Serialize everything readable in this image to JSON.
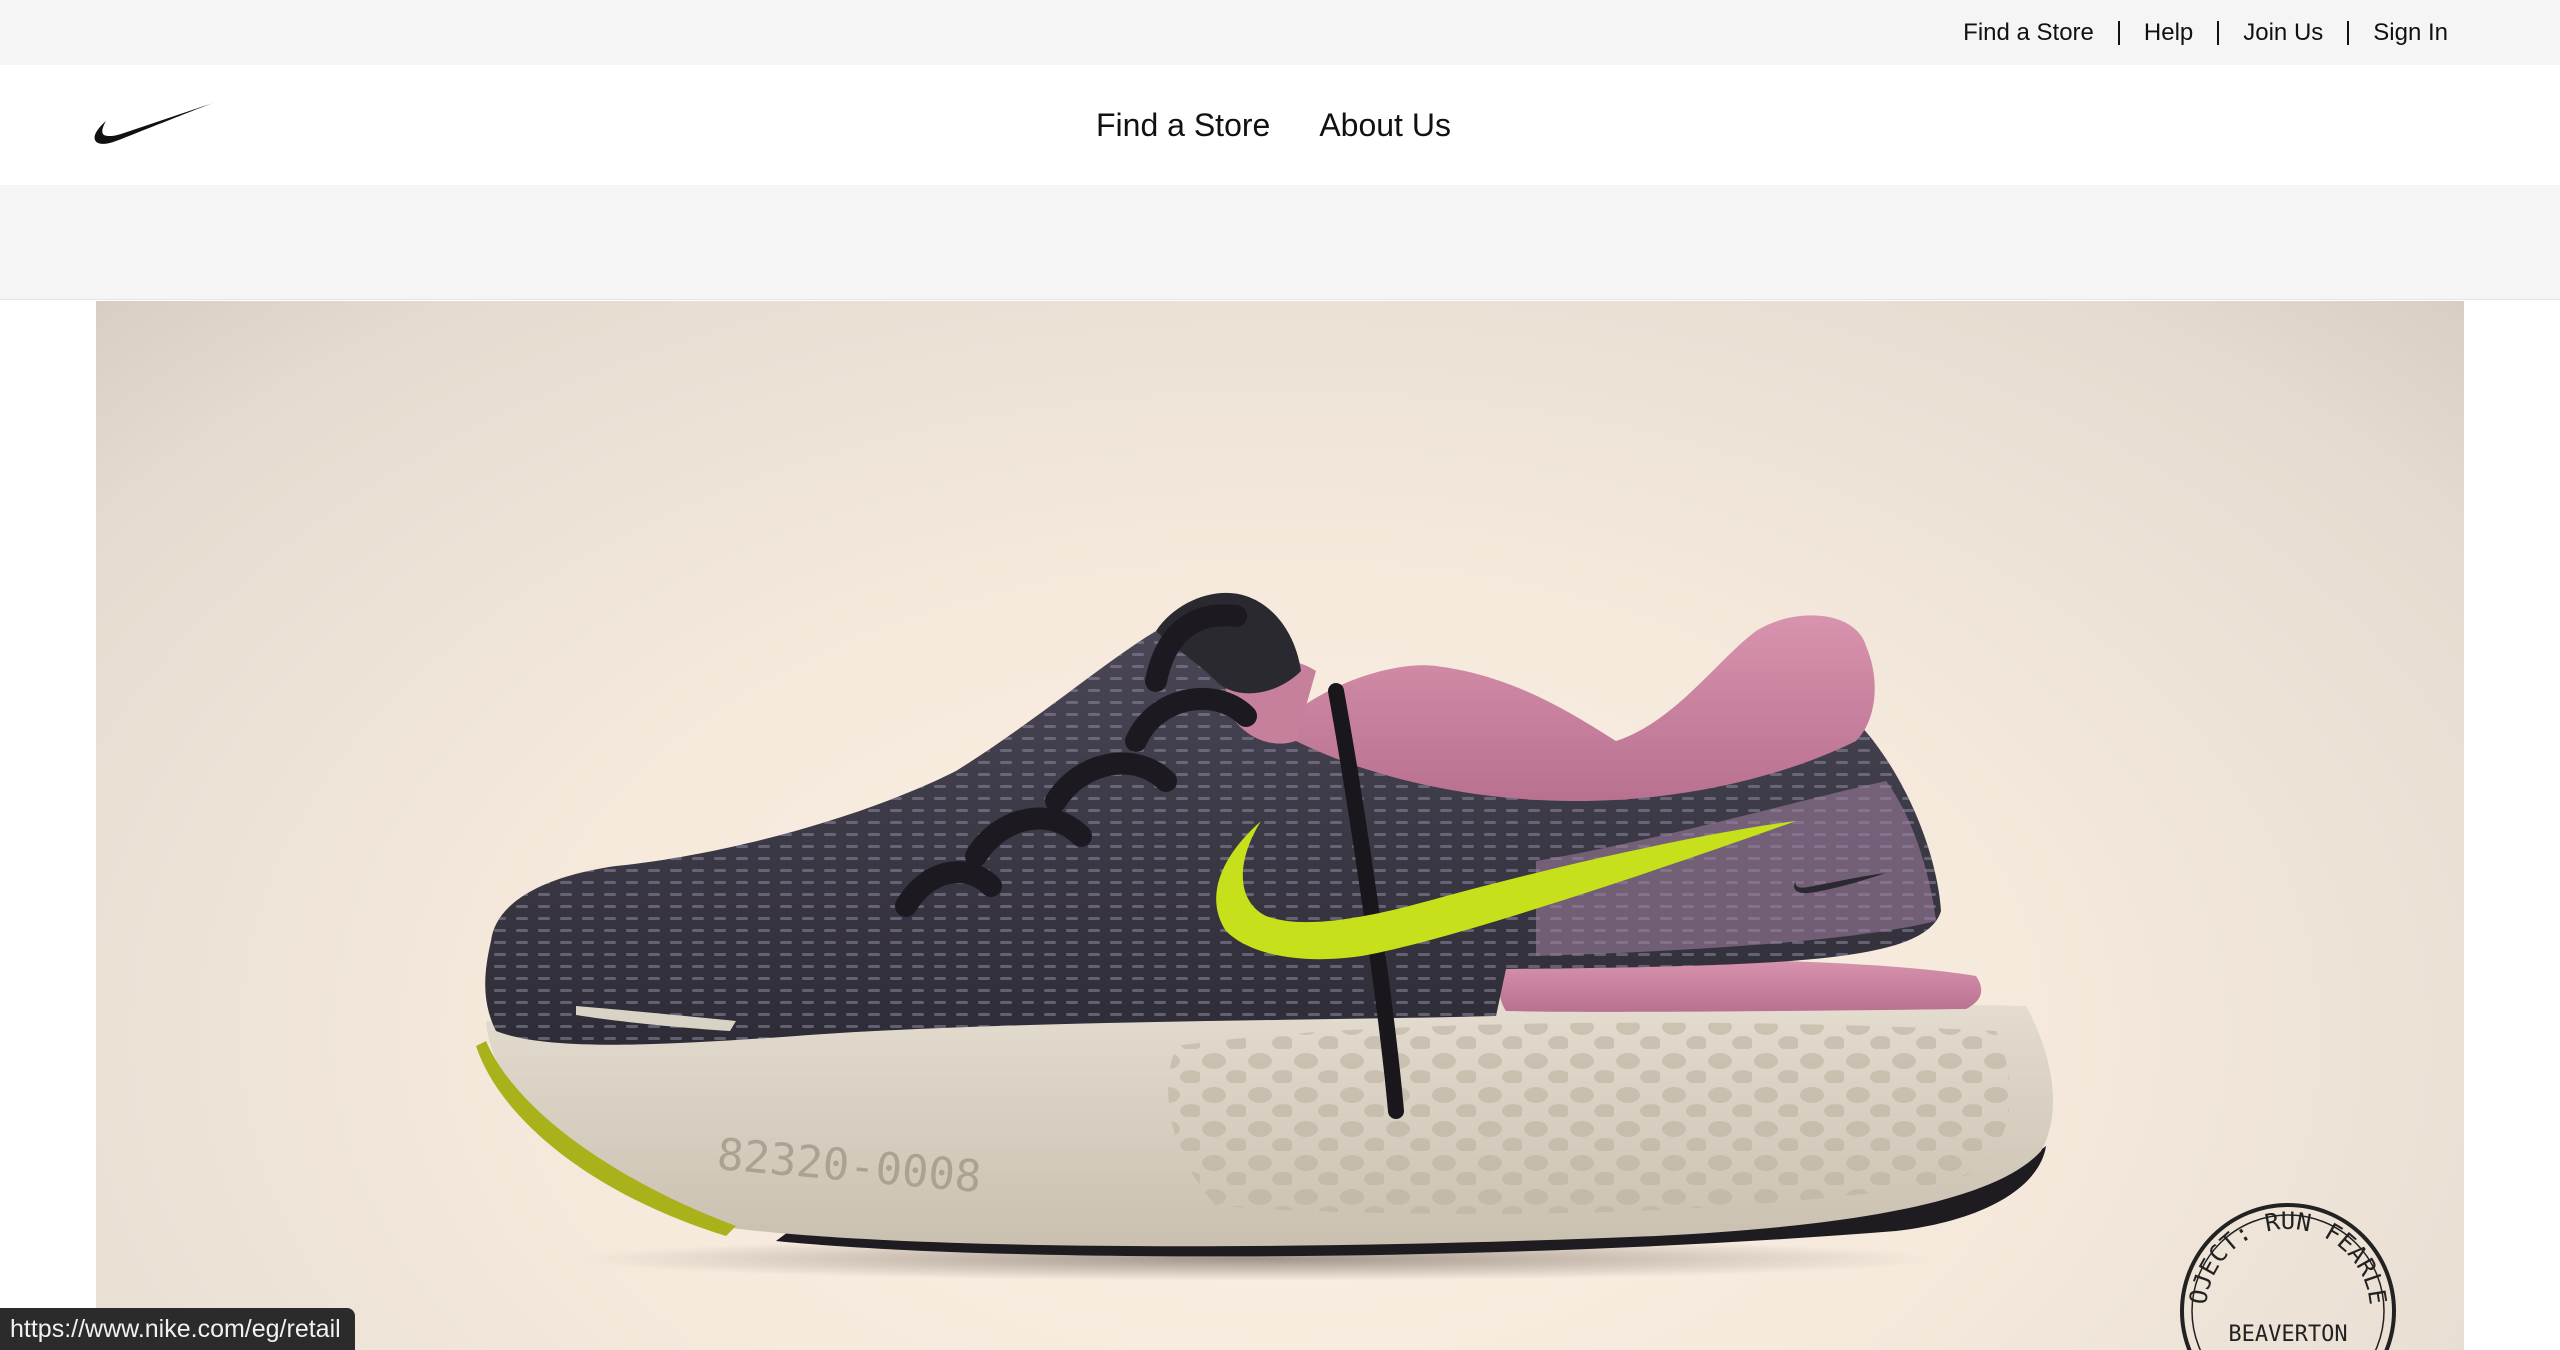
{
  "utility_nav": {
    "links": [
      "Find a Store",
      "Help",
      "Join Us",
      "Sign In"
    ]
  },
  "header": {
    "logo": "nike-swoosh-logo",
    "nav": [
      "Find a Store",
      "About Us"
    ]
  },
  "hero": {
    "image": "worn-running-shoe-photo",
    "midsole_print": "82320-0008",
    "stamp_top": "PROJECT: RUN FEARLESS",
    "stamp_bottom": "BEAVERTON"
  },
  "status_bar": {
    "url": "https://www.nike.com/eg/retail"
  },
  "colors": {
    "utility_bg": "#f5f5f5",
    "header_bg": "#ffffff",
    "text": "#111111",
    "swoosh_accent": "#c6e11b",
    "collar_pink": "#cf8aa5"
  }
}
